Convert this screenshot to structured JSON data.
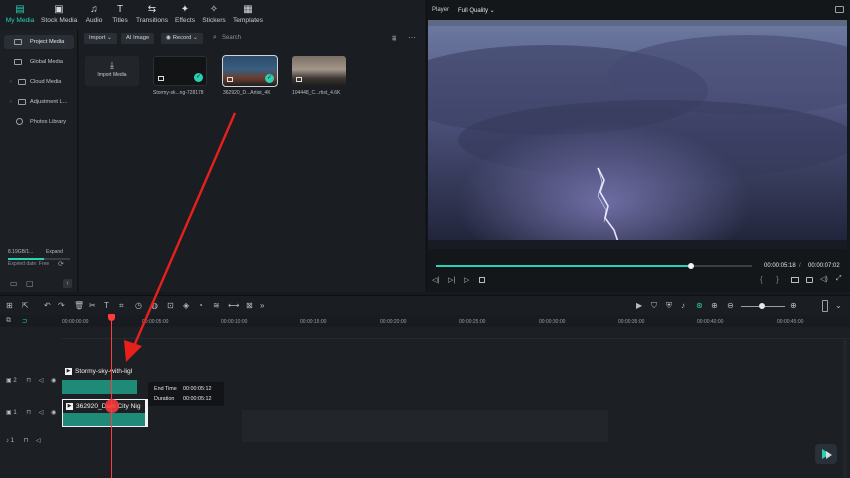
{
  "top_toolbar": {
    "items": [
      {
        "label": "My Media",
        "icon": "my-media-icon",
        "active": true
      },
      {
        "label": "Stock Media",
        "icon": "stock-media-icon"
      },
      {
        "label": "Audio",
        "icon": "audio-icon"
      },
      {
        "label": "Titles",
        "icon": "titles-icon"
      },
      {
        "label": "Transitions",
        "icon": "transitions-icon"
      },
      {
        "label": "Effects",
        "icon": "effects-icon"
      },
      {
        "label": "Stickers",
        "icon": "stickers-icon"
      },
      {
        "label": "Templates",
        "icon": "templates-icon"
      }
    ]
  },
  "sidebar": {
    "items": [
      {
        "label": "Project Media",
        "active": true
      },
      {
        "label": "Global Media"
      },
      {
        "label": "Cloud Media"
      },
      {
        "label": "Adjustment L..."
      },
      {
        "label": "Photos Library"
      }
    ],
    "storage": {
      "value": "8.19GB/1...",
      "expand": "Expand",
      "expired": "Expired date: Free",
      "fraction": 0.58
    }
  },
  "media": {
    "import_label": "Import",
    "ai_image_label": "AI Image",
    "record_label": "Record",
    "search_placeholder": "Search",
    "import_media_label": "Import Media",
    "items": [
      {
        "name": "Stormy-sk...ng-728178"
      },
      {
        "name": "362920_D...Artist_4K"
      },
      {
        "name": "104448_C...rtist_4.6K"
      }
    ]
  },
  "player": {
    "label": "Player",
    "quality": "Full Quality",
    "current_time": "00:00:05:18",
    "total_time": "00:00:07:02",
    "progress": 0.73
  },
  "timeline": {
    "ruler": [
      "00:00:00:00",
      "00:00:05:00",
      "00:00:10:00",
      "00:00:15:00",
      "00:00:20:00",
      "00:00:25:00",
      "00:00:30:00",
      "00:00:35:00",
      "00:00:40:00",
      "00:00:45:00"
    ],
    "tracks": [
      {
        "label": "2",
        "clip": "Stormy-sky-with-ligl"
      },
      {
        "label": "1",
        "clip": "362920_Dark City Nig"
      },
      {
        "label": "1"
      }
    ],
    "tooltip": {
      "end_time_label": "End Time",
      "end_time_value": "00:00:05:12",
      "duration_label": "Duration",
      "duration_value": "00:00:05:12"
    }
  },
  "colors": {
    "accent": "#2bd0b4",
    "playhead": "#ff3b3b",
    "clip": "#1f8a78",
    "annotation": "#e8201c"
  }
}
